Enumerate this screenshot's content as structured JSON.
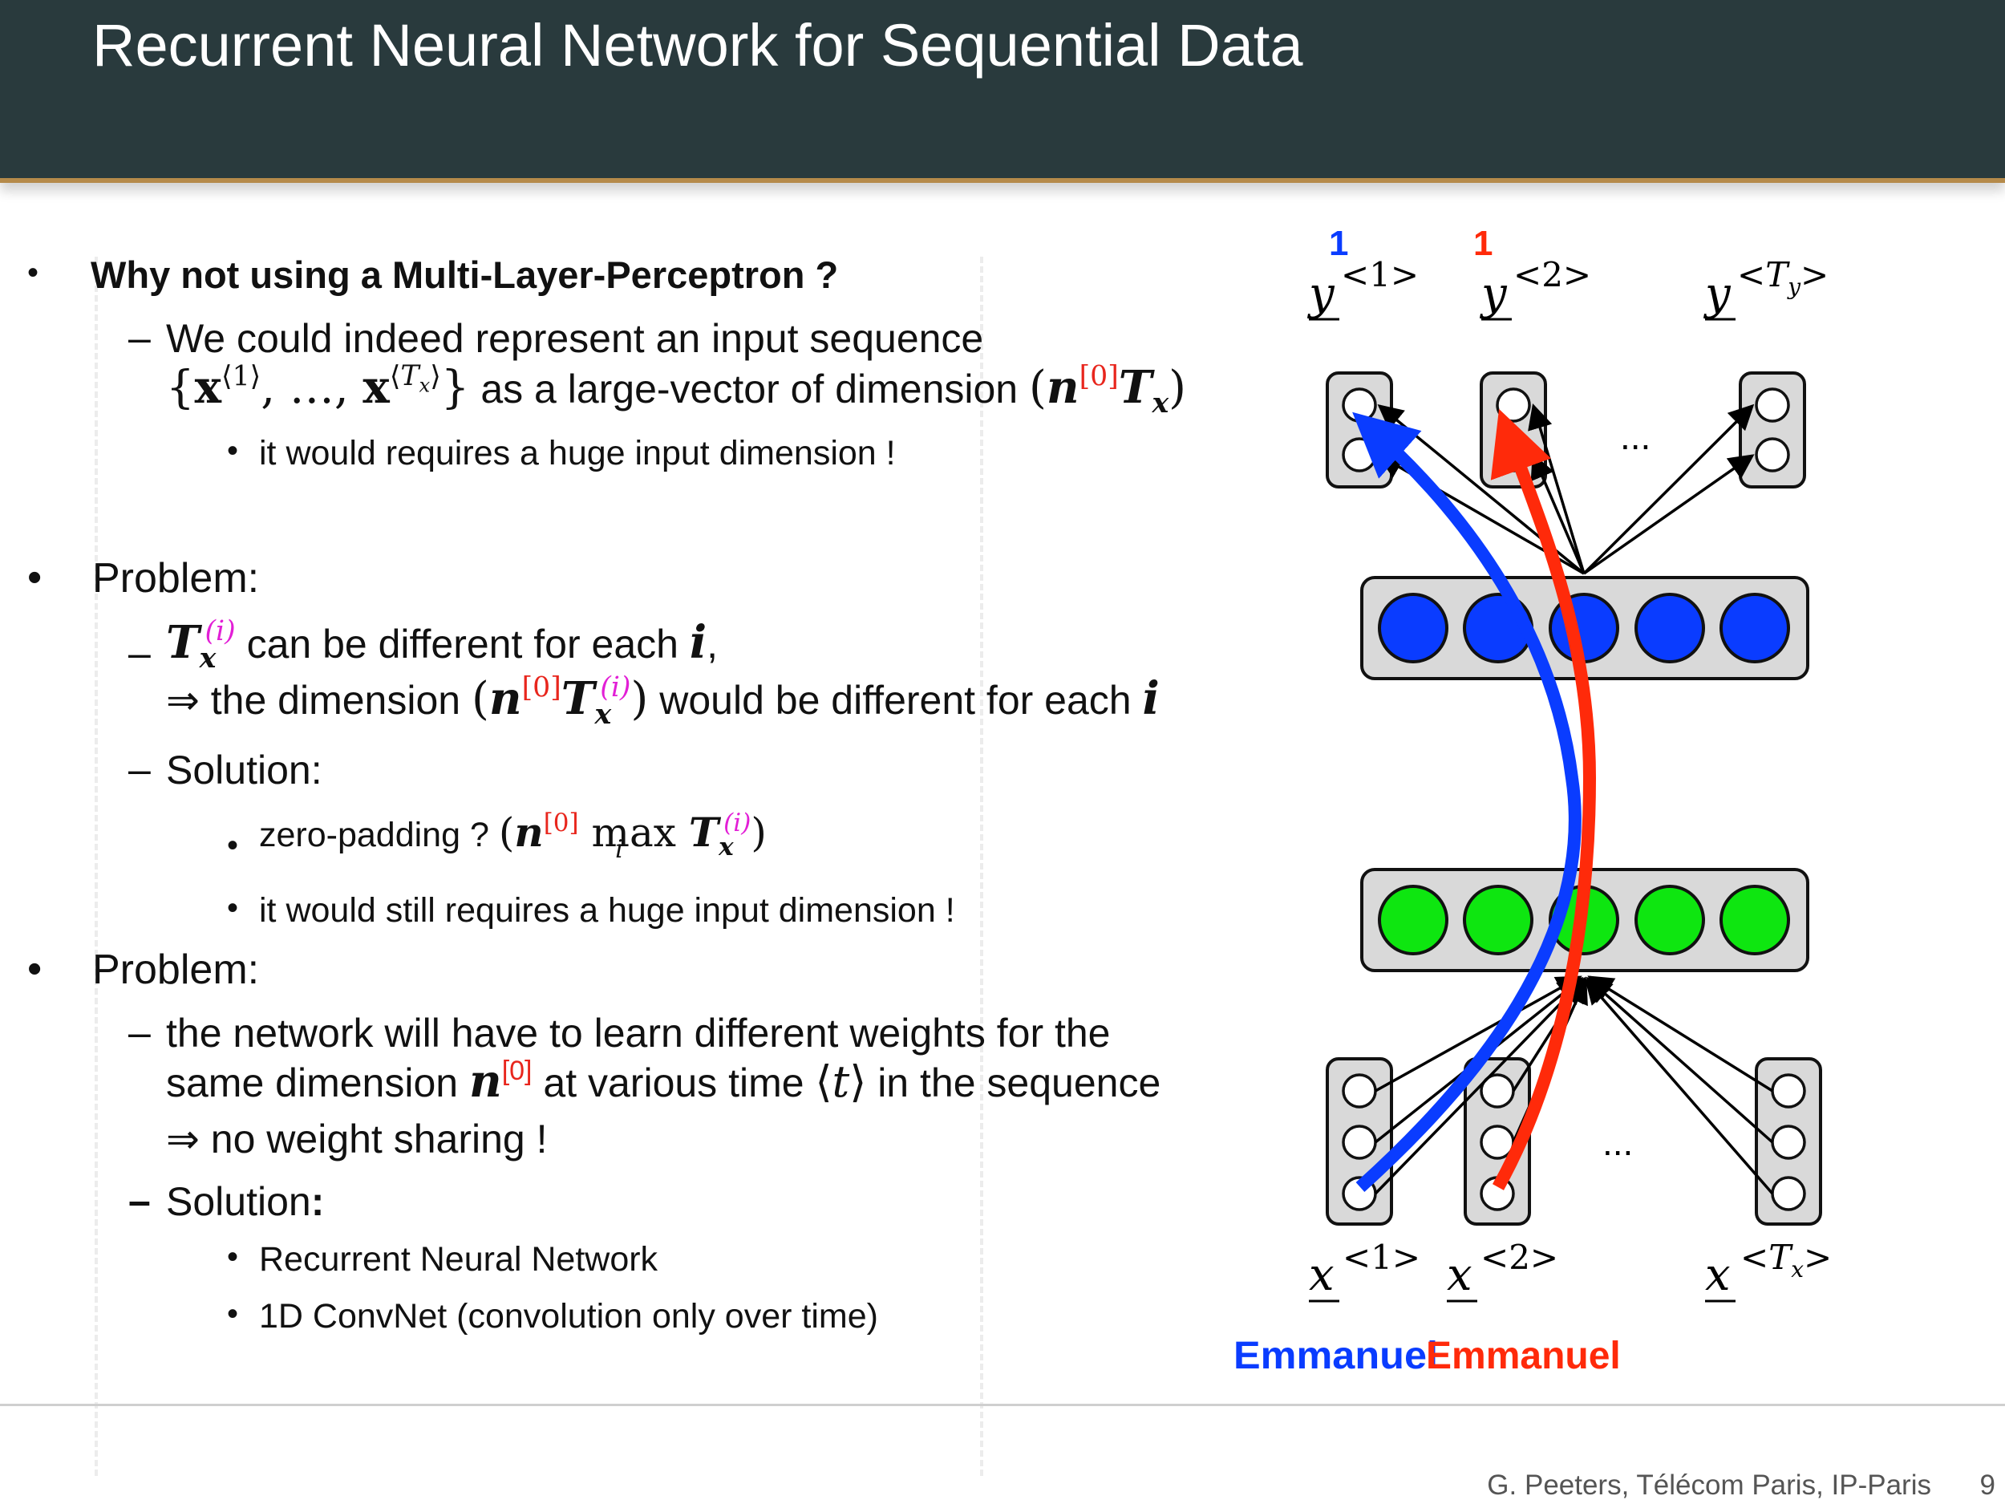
{
  "header": {
    "title": "Recurrent Neural Network for Sequential Data"
  },
  "content": {
    "b1": "Why not using a Multi-Layer-Perceptron ?",
    "b1_d1_l1": "We could indeed represent an input sequence",
    "b1_d1_l2_text": "as a large-vector of dimension",
    "b1_d1_dot": "it would requires a huge input dimension !",
    "p1": "Problem:",
    "p1_d1_l1": "can be different for each",
    "p1_d1_l2a": "⇒ the dimension",
    "p1_d1_l2b": "would be different for each",
    "p1_d2": "Solution:",
    "p1_d2_dot1": "zero-padding ?",
    "p1_d2_dot2": "it would still requires a huge input dimension !",
    "p2": "Problem:",
    "p2_d1_l1": "the network will have to learn different weights for the",
    "p2_d1_l2a": "same dimension",
    "p2_d1_l2b": "at various time",
    "p2_d1_l2c": "in the sequence",
    "p2_d1_l3": "⇒ no weight sharing !",
    "p2_d2": "Solution",
    "p2_d2_dot1": "Recurrent Neural Network",
    "p2_d2_dot2": "1D ConvNet (convolution only over time)"
  },
  "diagram": {
    "label_blue_num": "1",
    "label_red_num": "1",
    "label_blue_name": "Emmanuel",
    "label_red_name": "Emmanuel",
    "ellipsis_top": "...",
    "ellipsis_bottom": "...",
    "colors": {
      "hidden_top": "#0a3cff",
      "hidden_bottom": "#0ee610",
      "arrow_blue": "#0a3cff",
      "arrow_red": "#ff2a0a",
      "box_fill": "#d9d9d9"
    }
  },
  "footer": {
    "text": "G. Peeters, Télécom Paris, IP-Paris",
    "page": "9"
  }
}
